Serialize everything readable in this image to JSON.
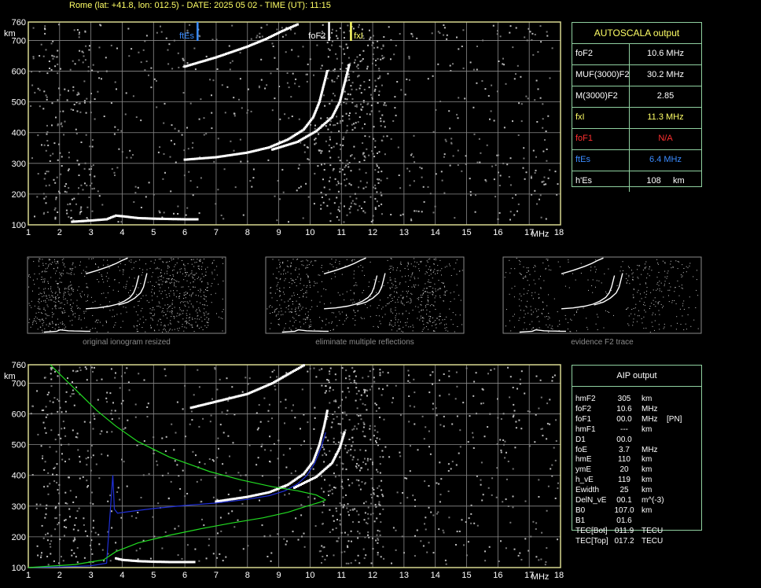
{
  "header": "Rome (lat: +41.8, lon: 012.5) - DATE: 2025 05 02 - TIME (UT): 11:15",
  "colors": {
    "frame": "#d8d890",
    "panel_border": "#8fd0a0",
    "yellow": "#ffff66",
    "red": "#ff3030",
    "blue": "#3a8cff",
    "green": "#22dd22",
    "darkblue": "#1f2fd8"
  },
  "autoscala": {
    "title": "AUTOSCALA output",
    "rows": [
      {
        "label": "foF2",
        "value": "10.6 MHz",
        "color": "#ffffff"
      },
      {
        "label": "MUF(3000)F2",
        "value": "30.2 MHz",
        "color": "#ffffff"
      },
      {
        "label": "M(3000)F2",
        "value": "2.85",
        "color": "#ffffff"
      },
      {
        "label": "fxI",
        "value": "11.3 MHz",
        "color": "#ffff66"
      },
      {
        "label": "foF1",
        "value": "N/A",
        "color": "#ff3030"
      },
      {
        "label": "ftEs",
        "value": "6.4 MHz",
        "color": "#3a8cff"
      },
      {
        "label": "h'Es",
        "value": "108     km",
        "color": "#ffffff"
      }
    ]
  },
  "aip": {
    "title": "AIP output",
    "rows": [
      [
        "hmF2",
        "305",
        "km",
        ""
      ],
      [
        "foF2",
        "10.6",
        "MHz",
        ""
      ],
      [
        "foF1",
        "00.0",
        "MHz",
        "[PN]"
      ],
      [
        "hmF1",
        "---",
        "km",
        ""
      ],
      [
        "D1",
        "00.0",
        "",
        ""
      ],
      [
        "foE",
        "3.7",
        "MHz",
        ""
      ],
      [
        "hmE",
        "110",
        "km",
        ""
      ],
      [
        "ymE",
        "20",
        "km",
        ""
      ],
      [
        "h_vE",
        "119",
        "km",
        ""
      ],
      [
        "Ewidth",
        "25",
        "km",
        ""
      ],
      [
        "DelN_vE",
        "00.1",
        "m^(-3)",
        ""
      ],
      [
        "B0",
        "107.0",
        "km",
        ""
      ],
      [
        "B1",
        "01.6",
        "",
        ""
      ],
      [
        "TEC[Bot]",
        "011.9",
        "TECU",
        ""
      ],
      [
        "TEC[Top]",
        "017.2",
        "TECU",
        ""
      ]
    ]
  },
  "thumbnails": [
    {
      "caption": "original ionogram resized"
    },
    {
      "caption": "eliminate multiple reflections"
    },
    {
      "caption": "evidence F2 trace"
    }
  ],
  "chart_data": [
    {
      "type": "scatter",
      "xlabel": "MHz",
      "ylabel": "km",
      "xlim": [
        1,
        18
      ],
      "ylim": [
        100,
        760
      ],
      "x_ticks": [
        1,
        2,
        3,
        4,
        5,
        6,
        7,
        8,
        9,
        10,
        11,
        12,
        13,
        14,
        15,
        16,
        17,
        18
      ],
      "y_ticks": [
        100,
        200,
        300,
        400,
        500,
        600,
        700,
        760
      ],
      "grid": true,
      "markers": [
        {
          "label": "ftEs",
          "x": 6.4,
          "color": "#3a8cff"
        },
        {
          "label": "foF2",
          "x": 10.6,
          "color": "#ffffff"
        },
        {
          "label": "fxI",
          "x": 11.3,
          "color": "#ffff66"
        }
      ],
      "series": [
        {
          "trace": "E-sporadic",
          "color": "#ffffff",
          "points": [
            [
              2.4,
              110
            ],
            [
              3.0,
              114
            ],
            [
              3.5,
              118
            ],
            [
              3.8,
              130
            ],
            [
              4.0,
              128
            ],
            [
              4.5,
              122
            ],
            [
              5.0,
              120
            ],
            [
              5.5,
              119
            ],
            [
              6.0,
              118
            ],
            [
              6.4,
              118
            ]
          ]
        },
        {
          "trace": "F2 ordinary",
          "color": "#ffffff",
          "points": [
            [
              6.0,
              312
            ],
            [
              7.0,
              320
            ],
            [
              8.0,
              335
            ],
            [
              8.7,
              352
            ],
            [
              9.3,
              378
            ],
            [
              9.8,
              410
            ],
            [
              10.1,
              450
            ],
            [
              10.3,
              500
            ],
            [
              10.45,
              560
            ],
            [
              10.55,
              600
            ]
          ]
        },
        {
          "trace": "F2 extraordinary",
          "color": "#ffffff",
          "points": [
            [
              8.8,
              345
            ],
            [
              9.6,
              370
            ],
            [
              10.2,
              405
            ],
            [
              10.7,
              450
            ],
            [
              10.95,
              500
            ],
            [
              11.1,
              560
            ],
            [
              11.25,
              620
            ]
          ]
        },
        {
          "trace": "F2 multiple",
          "color": "#ffffff",
          "points": [
            [
              6.0,
              615
            ],
            [
              7.0,
              645
            ],
            [
              8.0,
              680
            ],
            [
              8.6,
              705
            ],
            [
              9.1,
              730
            ],
            [
              9.6,
              752
            ]
          ]
        }
      ]
    },
    {
      "type": "line",
      "xlabel": "MHz",
      "ylabel": "km",
      "xlim": [
        1,
        18
      ],
      "ylim": [
        100,
        760
      ],
      "x_ticks": [
        1,
        2,
        3,
        4,
        5,
        6,
        7,
        8,
        9,
        10,
        11,
        12,
        13,
        14,
        15,
        16,
        17,
        18
      ],
      "y_ticks": [
        100,
        200,
        300,
        400,
        500,
        600,
        700,
        760
      ],
      "grid": true,
      "series": [
        {
          "trace": "E-sporadic",
          "style": "points",
          "color": "#ffffff",
          "points": [
            [
              3.8,
              130
            ],
            [
              4.0,
              125
            ],
            [
              4.5,
              121
            ],
            [
              5.0,
              119
            ],
            [
              5.5,
              118
            ],
            [
              6.0,
              118
            ],
            [
              6.3,
              118
            ]
          ]
        },
        {
          "trace": "F2 ordinary",
          "style": "points",
          "color": "#ffffff",
          "points": [
            [
              7.0,
              315
            ],
            [
              8.0,
              330
            ],
            [
              8.7,
              345
            ],
            [
              9.3,
              370
            ],
            [
              9.8,
              405
            ],
            [
              10.1,
              445
            ],
            [
              10.3,
              500
            ],
            [
              10.45,
              560
            ],
            [
              10.55,
              610
            ]
          ]
        },
        {
          "trace": "F2 extraordinary",
          "style": "points",
          "color": "#ffffff",
          "points": [
            [
              9.5,
              360
            ],
            [
              10.2,
              395
            ],
            [
              10.7,
              440
            ],
            [
              10.95,
              490
            ],
            [
              11.1,
              540
            ]
          ]
        },
        {
          "trace": "F2 multiple",
          "style": "points",
          "color": "#ffffff",
          "points": [
            [
              6.2,
              620
            ],
            [
              7.0,
              640
            ],
            [
              8.0,
              665
            ],
            [
              8.8,
              700
            ],
            [
              9.4,
              735
            ],
            [
              9.8,
              758
            ]
          ]
        },
        {
          "trace": "virtual height",
          "style": "line",
          "color": "#1f2fd8",
          "points": [
            [
              1.0,
              100
            ],
            [
              2.0,
              102
            ],
            [
              3.0,
              106
            ],
            [
              3.5,
              114
            ],
            [
              3.7,
              400
            ],
            [
              3.75,
              290
            ],
            [
              3.85,
              277
            ],
            [
              4.2,
              282
            ],
            [
              5.0,
              292
            ],
            [
              6.0,
              302
            ],
            [
              7.0,
              310
            ],
            [
              8.0,
              322
            ],
            [
              8.7,
              334
            ],
            [
              9.2,
              350
            ],
            [
              9.6,
              372
            ],
            [
              9.9,
              400
            ],
            [
              10.15,
              440
            ],
            [
              10.35,
              490
            ],
            [
              10.5,
              540
            ]
          ]
        },
        {
          "trace": "electron density below peak",
          "style": "line",
          "color": "#22dd22",
          "points": [
            [
              1.0,
              100
            ],
            [
              2.5,
              110
            ],
            [
              3.4,
              125
            ],
            [
              3.8,
              152
            ],
            [
              4.5,
              180
            ],
            [
              5.5,
              205
            ],
            [
              6.5,
              226
            ],
            [
              7.5,
              245
            ],
            [
              8.5,
              262
            ],
            [
              9.3,
              280
            ],
            [
              9.9,
              300
            ],
            [
              10.3,
              312
            ],
            [
              10.5,
              320
            ]
          ]
        },
        {
          "trace": "electron density above peak",
          "style": "line",
          "color": "#22dd22",
          "points": [
            [
              10.5,
              320
            ],
            [
              10.2,
              336
            ],
            [
              9.6,
              350
            ],
            [
              8.8,
              363
            ],
            [
              7.8,
              385
            ],
            [
              6.8,
              412
            ],
            [
              5.5,
              460
            ],
            [
              4.5,
              510
            ],
            [
              3.8,
              560
            ],
            [
              3.2,
              610
            ],
            [
              2.7,
              660
            ],
            [
              2.3,
              700
            ],
            [
              1.9,
              740
            ],
            [
              1.7,
              760
            ]
          ]
        }
      ]
    }
  ]
}
